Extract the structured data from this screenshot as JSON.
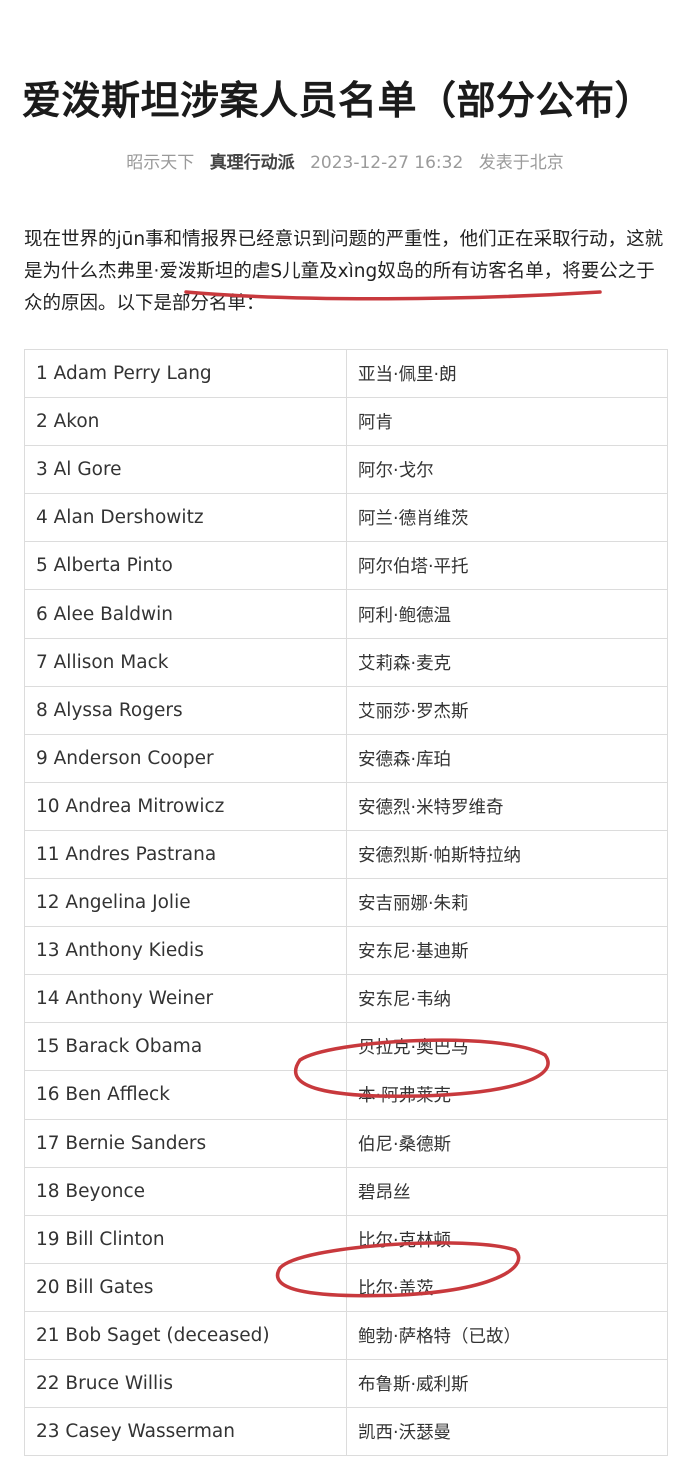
{
  "article": {
    "title": "爱泼斯坦涉案人员名单（部分公布）",
    "source": "昭示天下",
    "author": "真理行动派",
    "datetime": "2023-12-27 16:32",
    "location": "发表于北京"
  },
  "intro": {
    "part1": "现在世界的jūn事和情报界已经意识到问题的严重性，他们正在采取行动，这就是为什么杰弗里·",
    "highlight": "爱泼斯坦的虐S儿童及xìng奴岛的所有访客名单",
    "part2": "，将要公之于众的原因。以下是部分名单："
  },
  "annotations": {
    "mark_color": "#c8393d"
  },
  "table": {
    "rows": [
      {
        "en": "1 Adam Perry Lang",
        "cn": "亚当·佩里·朗"
      },
      {
        "en": "2 Akon",
        "cn": "阿肯"
      },
      {
        "en": "3 Al Gore",
        "cn": "阿尔·戈尔"
      },
      {
        "en": "4 Alan Dershowitz",
        "cn": "阿兰·德肖维茨"
      },
      {
        "en": "5 Alberta Pinto",
        "cn": "阿尔伯塔·平托"
      },
      {
        "en": "6 Alee Baldwin",
        "cn": "阿利·鲍德温"
      },
      {
        "en": "7 Allison Mack",
        "cn": "艾莉森·麦克"
      },
      {
        "en": "8 Alyssa Rogers",
        "cn": "艾丽莎·罗杰斯"
      },
      {
        "en": "9 Anderson Cooper",
        "cn": "安德森·库珀"
      },
      {
        "en": "10 Andrea Mitrowicz",
        "cn": "安德烈·米特罗维奇"
      },
      {
        "en": "11 Andres Pastrana",
        "cn": "安德烈斯·帕斯特拉纳"
      },
      {
        "en": "12 Angelina Jolie",
        "cn": "安吉丽娜·朱莉"
      },
      {
        "en": "13 Anthony Kiedis",
        "cn": "安东尼·基迪斯"
      },
      {
        "en": "14 Anthony Weiner",
        "cn": "安东尼·韦纳"
      },
      {
        "en": "15 Barack Obama",
        "cn": "贝拉克·奥巴马"
      },
      {
        "en": "16 Ben Affleck",
        "cn": "本·阿弗莱克"
      },
      {
        "en": "17 Bernie Sanders",
        "cn": "伯尼·桑德斯"
      },
      {
        "en": "18 Beyonce",
        "cn": "碧昂丝"
      },
      {
        "en": "19 Bill Clinton",
        "cn": "比尔·克林顿"
      },
      {
        "en": "20 Bill Gates",
        "cn": "比尔·盖茨"
      },
      {
        "en": "21 Bob Saget (deceased)",
        "cn": "鲍勃·萨格特（已故）"
      },
      {
        "en": "22 Bruce Willis",
        "cn": "布鲁斯·威利斯"
      },
      {
        "en": "23 Casey Wasserman",
        "cn": "凯西·沃瑟曼"
      }
    ]
  }
}
